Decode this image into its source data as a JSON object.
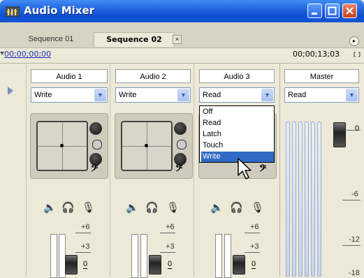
{
  "window": {
    "title": "Audio Mixer",
    "colors": {
      "titlebar": "#1f62dd",
      "background": "#ece9d8",
      "highlight": "#316ac5"
    }
  },
  "tabs": [
    {
      "label": "Sequence 01",
      "active": false
    },
    {
      "label": "Sequence 02",
      "active": true,
      "close_label": "×"
    }
  ],
  "timecode": {
    "current": "00;00;00;00",
    "duration": "00;00;13;03"
  },
  "tracks": [
    {
      "label": "Audio 1",
      "automation": "Write",
      "scale": [
        "+6",
        "+3",
        "0"
      ]
    },
    {
      "label": "Audio 2",
      "automation": "Write",
      "scale": [
        "+6",
        "+3",
        "0"
      ]
    },
    {
      "label": "Audio 3",
      "automation": "Read",
      "scale": [
        "+6",
        "+3",
        "0"
      ]
    }
  ],
  "master": {
    "label": "Master",
    "automation": "Read",
    "scale": [
      "0",
      "-6",
      "-12",
      "-18"
    ]
  },
  "automation_menu": {
    "options": [
      "Off",
      "Read",
      "Latch",
      "Touch",
      "Write"
    ],
    "highlighted": "Write"
  },
  "icons": {
    "menu": "panel-menu-icon",
    "expand": "expand-arrow-icon",
    "mute": "speaker-icon",
    "solo": "headphones-icon",
    "record": "microphone-icon"
  }
}
